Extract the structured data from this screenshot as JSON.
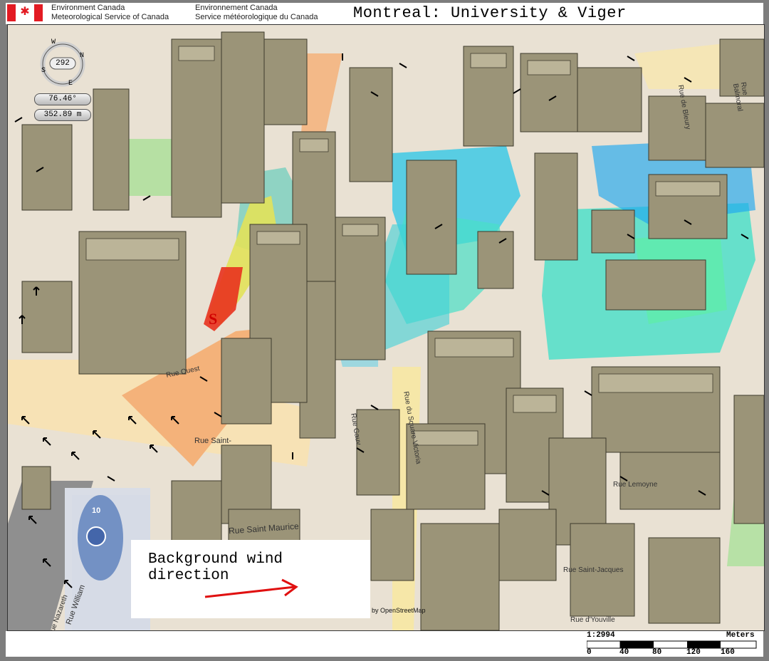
{
  "header": {
    "agency_en_1": "Environment Canada",
    "agency_en_2": "Meteorological Service of Canada",
    "agency_fr_1": "Environnement Canada",
    "agency_fr_2": "Service météorologique du Canada",
    "title": "Montreal: University & Viger"
  },
  "compass": {
    "n": "N",
    "s": "S",
    "e": "E",
    "w": "W",
    "heading": "292",
    "tilt": "76.46°",
    "altitude": "352.89 m"
  },
  "map": {
    "streets": [
      "Rue Saint Maurice",
      "Rue William",
      "Rue Nazareth",
      "Rue Saint-",
      "Rue Ouest",
      "Rue Gauv",
      "Rue du Square Victoria",
      "Rue Balmoral",
      "Rue de Bleury",
      "Rue d'Youville",
      "Rue Lemoyne",
      "Rue Saint-Jacques"
    ],
    "highway_badge": "10",
    "marker": "S",
    "credit": "by OpenStreetMap",
    "colors": {
      "wind_hot": "#e8321e",
      "wind_mid": "#f0e050",
      "wind_cool": "#19d2e6",
      "wind_cold": "#2a6be0"
    }
  },
  "legend": {
    "text_line1": "Background wind",
    "text_line2": "direction",
    "arrow_color": "#e01010"
  },
  "scale": {
    "ratio": "1:2994",
    "unit": "Meters",
    "ticks": [
      "0",
      "40",
      "80",
      "120",
      "160"
    ]
  }
}
